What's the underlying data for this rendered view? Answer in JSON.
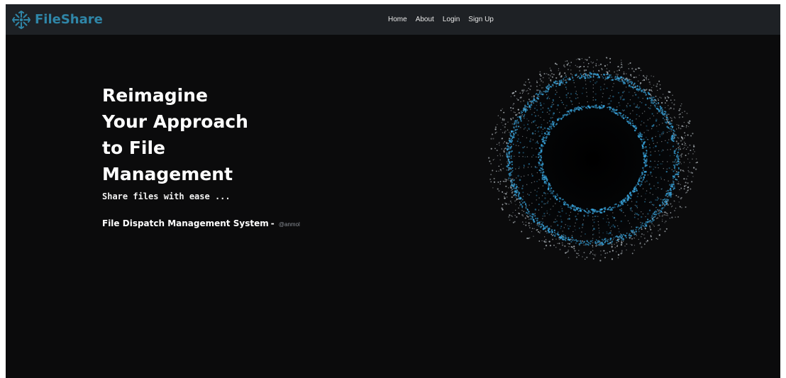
{
  "brand": {
    "name": "FileShare",
    "icon": "asterisk-gear-logo-icon",
    "color": "#2f86a8"
  },
  "nav": {
    "items": [
      {
        "label": "Home"
      },
      {
        "label": "About"
      },
      {
        "label": "Login"
      },
      {
        "label": "Sign Up"
      }
    ]
  },
  "hero": {
    "title_lines": [
      "Reimagine",
      "Your Approach",
      "to File",
      "Management"
    ],
    "tagline": "Share files with ease ...",
    "system_name": "File Dispatch Management System",
    "separator": "-",
    "author": "@anmol"
  },
  "visual": {
    "icon": "particle-sphere-animation",
    "accent": "#3aa7e0",
    "particle": "#bcc3c9"
  },
  "colors": {
    "background": "#0b0b0c",
    "navbar": "#1e2125"
  }
}
